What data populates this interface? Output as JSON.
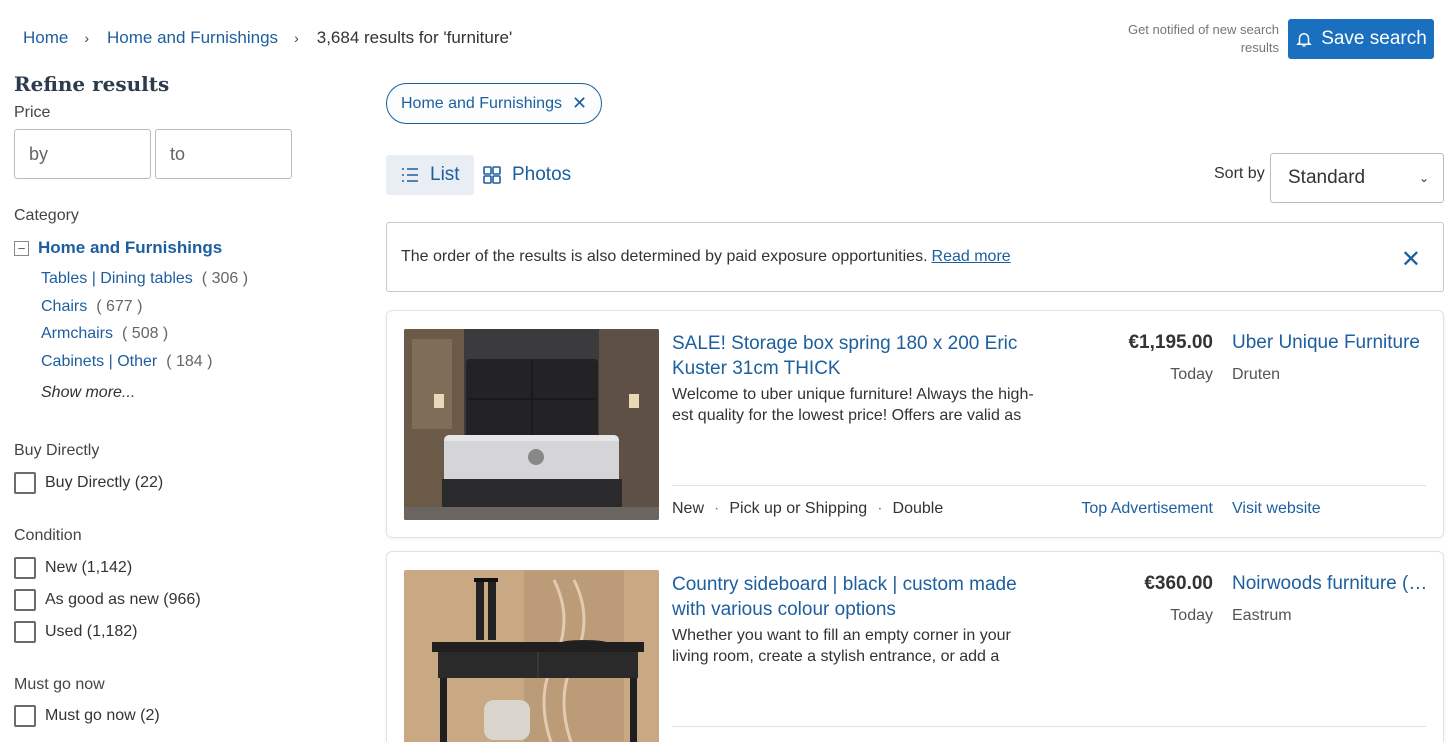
{
  "breadcrumb": {
    "items": [
      "Home",
      "Home and Furnishings"
    ],
    "current": "3,684 results for 'furniture'"
  },
  "header": {
    "notify_text": "Get notified of new search results",
    "save_label": "Save search"
  },
  "sidebar": {
    "title": "Refine results",
    "price": {
      "label": "Price",
      "from_placeholder": "by",
      "to_placeholder": "to"
    },
    "category": {
      "label": "Category",
      "root": "Home and Furnishings",
      "items": [
        {
          "name": "Tables | Dining tables",
          "count": "( 306 )"
        },
        {
          "name": "Chairs",
          "count": "( 677 )"
        },
        {
          "name": "Armchairs",
          "count": "( 508 )"
        },
        {
          "name": "Cabinets | Other",
          "count": "( 184 )"
        }
      ],
      "show_more": "Show more..."
    },
    "buy_directly": {
      "label": "Buy Directly",
      "option": "Buy Directly (22)"
    },
    "condition": {
      "label": "Condition",
      "options": [
        "New (1,142)",
        "As good as new (966)",
        "Used (1,182)"
      ]
    },
    "must_go": {
      "label": "Must go now",
      "option": "Must go now (2)"
    }
  },
  "main": {
    "chip_label": "Home and Furnishings",
    "view": {
      "list_label": "List",
      "photos_label": "Photos",
      "active": "list"
    },
    "sort": {
      "label": "Sort by",
      "selected": "Standard"
    },
    "notice": {
      "text": "The order of the results is also determined by paid exposure opportunities.",
      "link": "Read more"
    },
    "listings": [
      {
        "title": "SALE! Storage box spring 180 x 200 Eric Kuster 31cm THICK",
        "desc": "Welcome to uber unique furniture! Always the high-est quality for the lowest price! Offers are valid as long as stock lasts.",
        "price": "€1,195.00",
        "date": "Today",
        "seller": "Uber Unique Furniture",
        "city": "Druten",
        "attrs": [
          "New",
          "Pick up or Shipping",
          "Double"
        ],
        "badge": "Top Advertisement",
        "visit": "Visit website"
      },
      {
        "title": "Country sideboard | black | custom made with various colour options",
        "desc": "Whether you want to fill an empty corner in your living room, create a stylish entrance, or add a decorative touch.",
        "price": "€360.00",
        "date": "Today",
        "seller": "Noirwoods furniture (…",
        "city": "Eastrum"
      }
    ]
  },
  "colors": {
    "link": "#1d5f9e",
    "button": "#1a6fbf"
  }
}
